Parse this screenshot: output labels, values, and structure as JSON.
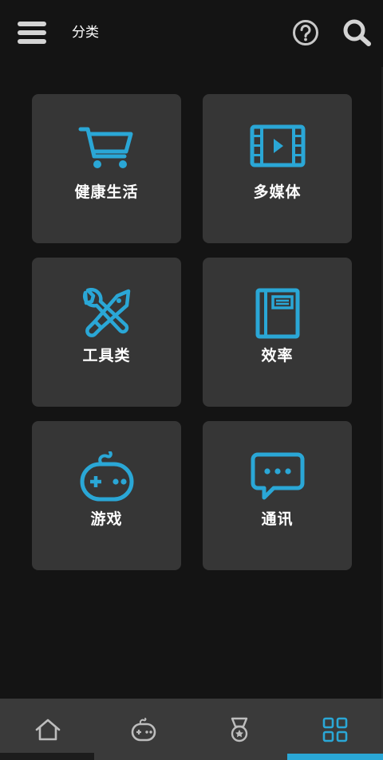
{
  "header": {
    "title": "分类"
  },
  "categories": [
    {
      "label": "健康生活",
      "icon": "shopping-cart-icon"
    },
    {
      "label": "多媒体",
      "icon": "film-play-icon"
    },
    {
      "label": "工具类",
      "icon": "tools-icon"
    },
    {
      "label": "效率",
      "icon": "notebook-icon"
    },
    {
      "label": "游戏",
      "icon": "gamepad-icon"
    },
    {
      "label": "通讯",
      "icon": "chat-bubble-icon"
    }
  ],
  "bottom_nav": {
    "items": [
      {
        "icon": "home-icon"
      },
      {
        "icon": "gamepad-icon"
      },
      {
        "icon": "medal-icon"
      },
      {
        "icon": "grid-icon",
        "active": true
      }
    ]
  },
  "colors": {
    "background": "#141414",
    "tile": "#363636",
    "accent": "#2aa7d6",
    "nav_bg": "#3a3a3a",
    "icon_gray": "#bdbdbd"
  }
}
